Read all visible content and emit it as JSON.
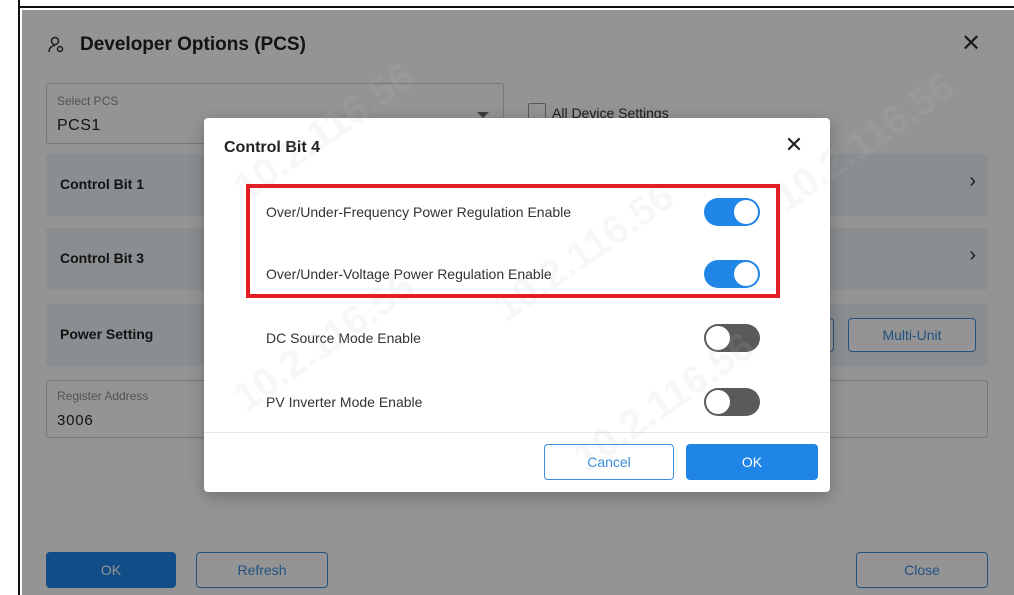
{
  "window": {
    "title": "Developer Options (PCS)",
    "close_glyph": "✕"
  },
  "select_pcs": {
    "label": "Select PCS",
    "value": "PCS1"
  },
  "all_device": {
    "label": "All Device Settings"
  },
  "sections": [
    {
      "label": "Control Bit 1",
      "chevron": "›"
    },
    {
      "label": "Control Bit 3",
      "chevron": "›"
    },
    {
      "label": "Power Setting"
    }
  ],
  "multi_unit_label": "Multi-Unit",
  "register": {
    "label": "Register Address",
    "value": "3006"
  },
  "footer": {
    "ok_label": "OK",
    "refresh_label": "Refresh",
    "close_label": "Close"
  },
  "modal": {
    "title": "Control Bit 4",
    "close_glyph": "✕",
    "options": [
      {
        "label": "Over/Under-Frequency Power Regulation Enable",
        "enabled": true
      },
      {
        "label": "Over/Under-Voltage Power Regulation Enable",
        "enabled": true
      },
      {
        "label": "DC Source Mode Enable",
        "enabled": false
      },
      {
        "label": "PV Inverter Mode Enable",
        "enabled": false
      }
    ],
    "cancel_label": "Cancel",
    "ok_label": "OK"
  },
  "watermark": {
    "text": "10.2.116.56"
  },
  "colors": {
    "accent": "#1f86e8",
    "highlight": "#e01f26",
    "toggle_off": "#5a5a5a"
  },
  "icons": {
    "title_icon": "user-settings-icon"
  }
}
